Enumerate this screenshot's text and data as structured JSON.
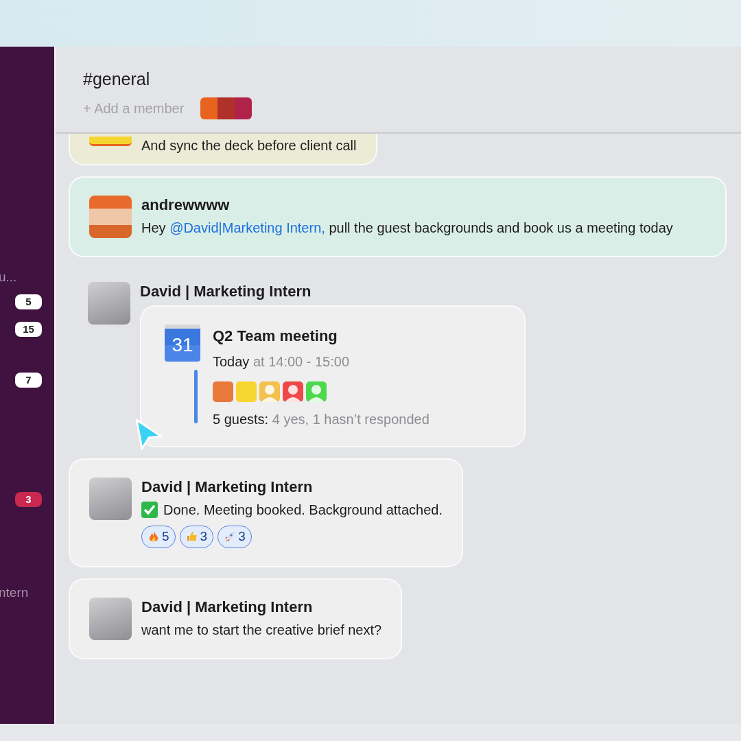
{
  "channel": {
    "title": "#general",
    "add_member": "+ Add a member",
    "member_avatars": [
      {
        "color": "#e8641e"
      },
      {
        "color": "#b0302a"
      },
      {
        "color": "#b0224a"
      }
    ]
  },
  "sidebar": {
    "items": [
      {
        "kind": "label",
        "text": "u..."
      },
      {
        "kind": "count",
        "text": "5",
        "alert": false
      },
      {
        "kind": "count",
        "text": "15",
        "alert": false
      },
      {
        "kind": "count",
        "text": "7",
        "alert": false
      },
      {
        "kind": "count",
        "text": "3",
        "alert": true
      },
      {
        "kind": "label",
        "text": "ntern"
      }
    ]
  },
  "messages": [
    {
      "kind": "text",
      "color": "#ecebd6",
      "text": "And sync the deck before client call"
    },
    {
      "kind": "mention",
      "color": "#d9eee6",
      "author": "andrewwww",
      "text_before": "Hey ",
      "mention": "@David|Marketing Intern,",
      "text_after": " pull the guest backgrounds and book us a meeting today"
    },
    {
      "kind": "event",
      "author": "David | Marketing Intern",
      "event": {
        "date": "31",
        "title": "Q2 Team meeting",
        "day": "Today",
        "time": "at 14:00 - 15:00",
        "guests": [
          {
            "kind": "photo",
            "color": "#e8793a"
          },
          {
            "kind": "photo",
            "color": "#f7d531"
          },
          {
            "kind": "person",
            "color": "#f2c14e"
          },
          {
            "kind": "person",
            "color": "#f04848"
          },
          {
            "kind": "person",
            "color": "#4cd94c"
          }
        ],
        "summary_label": "5 guests:",
        "summary": "4 yes, 1 hasn’t responded"
      }
    },
    {
      "kind": "text",
      "color": "#efeff0",
      "author": "David | Marketing Intern",
      "check": true,
      "text": "Done. Meeting booked. Background attached.",
      "reactions": [
        {
          "kind": "fire",
          "count": "5"
        },
        {
          "kind": "thumbs",
          "count": "3"
        },
        {
          "kind": "rocket",
          "count": "3"
        }
      ]
    },
    {
      "kind": "text",
      "color": "#efeff0",
      "author": "David | Marketing Intern",
      "text": " want me to start the creative brief next?"
    }
  ]
}
